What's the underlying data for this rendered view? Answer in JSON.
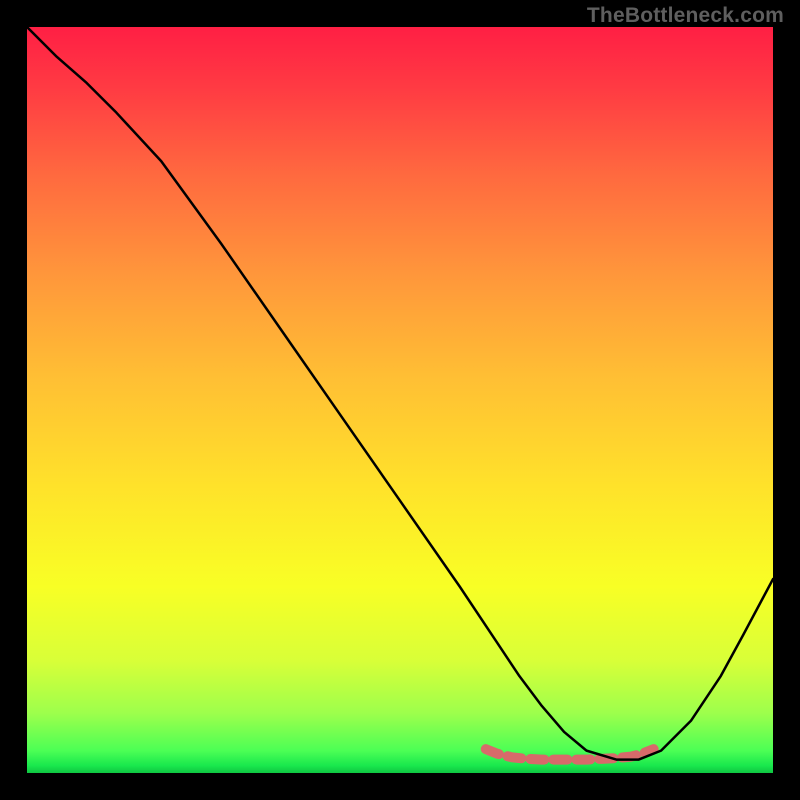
{
  "watermark": "TheBottleneck.com",
  "chart_data": {
    "type": "line",
    "title": "",
    "xlabel": "",
    "ylabel": "",
    "xlim": [
      0,
      100
    ],
    "ylim": [
      0,
      100
    ],
    "series": [
      {
        "name": "bottleneck-curve",
        "x": [
          0,
          4,
          8,
          12,
          18,
          26,
          34,
          42,
          50,
          58,
          63,
          66,
          69,
          72,
          75,
          79,
          82,
          85,
          89,
          93,
          96,
          100
        ],
        "y": [
          100,
          96,
          92.5,
          88.5,
          82,
          71,
          59.5,
          48,
          36.5,
          25,
          17.5,
          13,
          9,
          5.5,
          3,
          1.8,
          1.8,
          3,
          7,
          13,
          18.5,
          26
        ],
        "color": "#000000",
        "width": 2.5
      },
      {
        "name": "highlight-band",
        "x": [
          61.5,
          63,
          65,
          67,
          69,
          71,
          73,
          75,
          77,
          79,
          81,
          82.5,
          84
        ],
        "y": [
          3.2,
          2.6,
          2.1,
          1.9,
          1.8,
          1.8,
          1.8,
          1.8,
          1.9,
          2.0,
          2.2,
          2.6,
          3.2
        ],
        "color": "#d76a6a",
        "width": 10
      }
    ],
    "gradient_stops": [
      {
        "offset": 0,
        "color": "#ff1f44"
      },
      {
        "offset": 0.5,
        "color": "#ffe32a"
      },
      {
        "offset": 0.97,
        "color": "#4cff55"
      },
      {
        "offset": 1.0,
        "color": "#0fc642"
      }
    ]
  }
}
